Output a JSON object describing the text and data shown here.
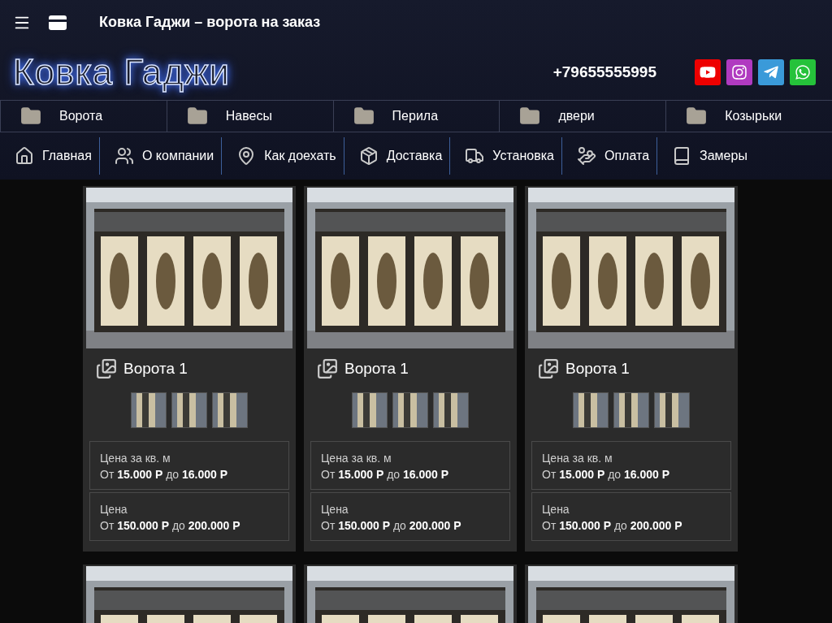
{
  "window": {
    "title": "Ковка Гаджи – ворота на заказ"
  },
  "header": {
    "logo": "Ковка Гаджи",
    "phone": "+79655555995"
  },
  "categories": [
    {
      "label": "Ворота"
    },
    {
      "label": "Навесы"
    },
    {
      "label": "Перила"
    },
    {
      "label": "двери"
    },
    {
      "label": "Козырьки"
    }
  ],
  "nav": [
    {
      "label": "Главная"
    },
    {
      "label": "О компании"
    },
    {
      "label": "Как доехать"
    },
    {
      "label": "Доставка"
    },
    {
      "label": "Установка"
    },
    {
      "label": "Оплата"
    },
    {
      "label": "Замеры"
    }
  ],
  "cards": [
    {
      "kind": "full",
      "title": "Ворота 1",
      "prices": [
        {
          "label": "Цена за кв. м",
          "range": "От **15.000 Р** до **16.000 Р**"
        },
        {
          "label": "Цена",
          "range": "От **150.000 Р** до **200.000 Р**"
        }
      ]
    },
    {
      "kind": "full",
      "title": "Ворота 1",
      "prices": [
        {
          "label": "Цена за кв. м",
          "range": "От **15.000 Р** до **16.000 Р**"
        },
        {
          "label": "Цена",
          "range": "От **150.000 Р** до **200.000 Р**"
        }
      ]
    },
    {
      "kind": "full",
      "title": "Ворота 1",
      "prices": [
        {
          "label": "Цена за кв. м",
          "range": "От **15.000 Р** до **16.000 Р**"
        },
        {
          "label": "Цена",
          "range": "От **150.000 Р** до **200.000 Р**"
        }
      ]
    },
    {
      "kind": "cut"
    },
    {
      "kind": "cut"
    },
    {
      "kind": "cut"
    }
  ]
}
